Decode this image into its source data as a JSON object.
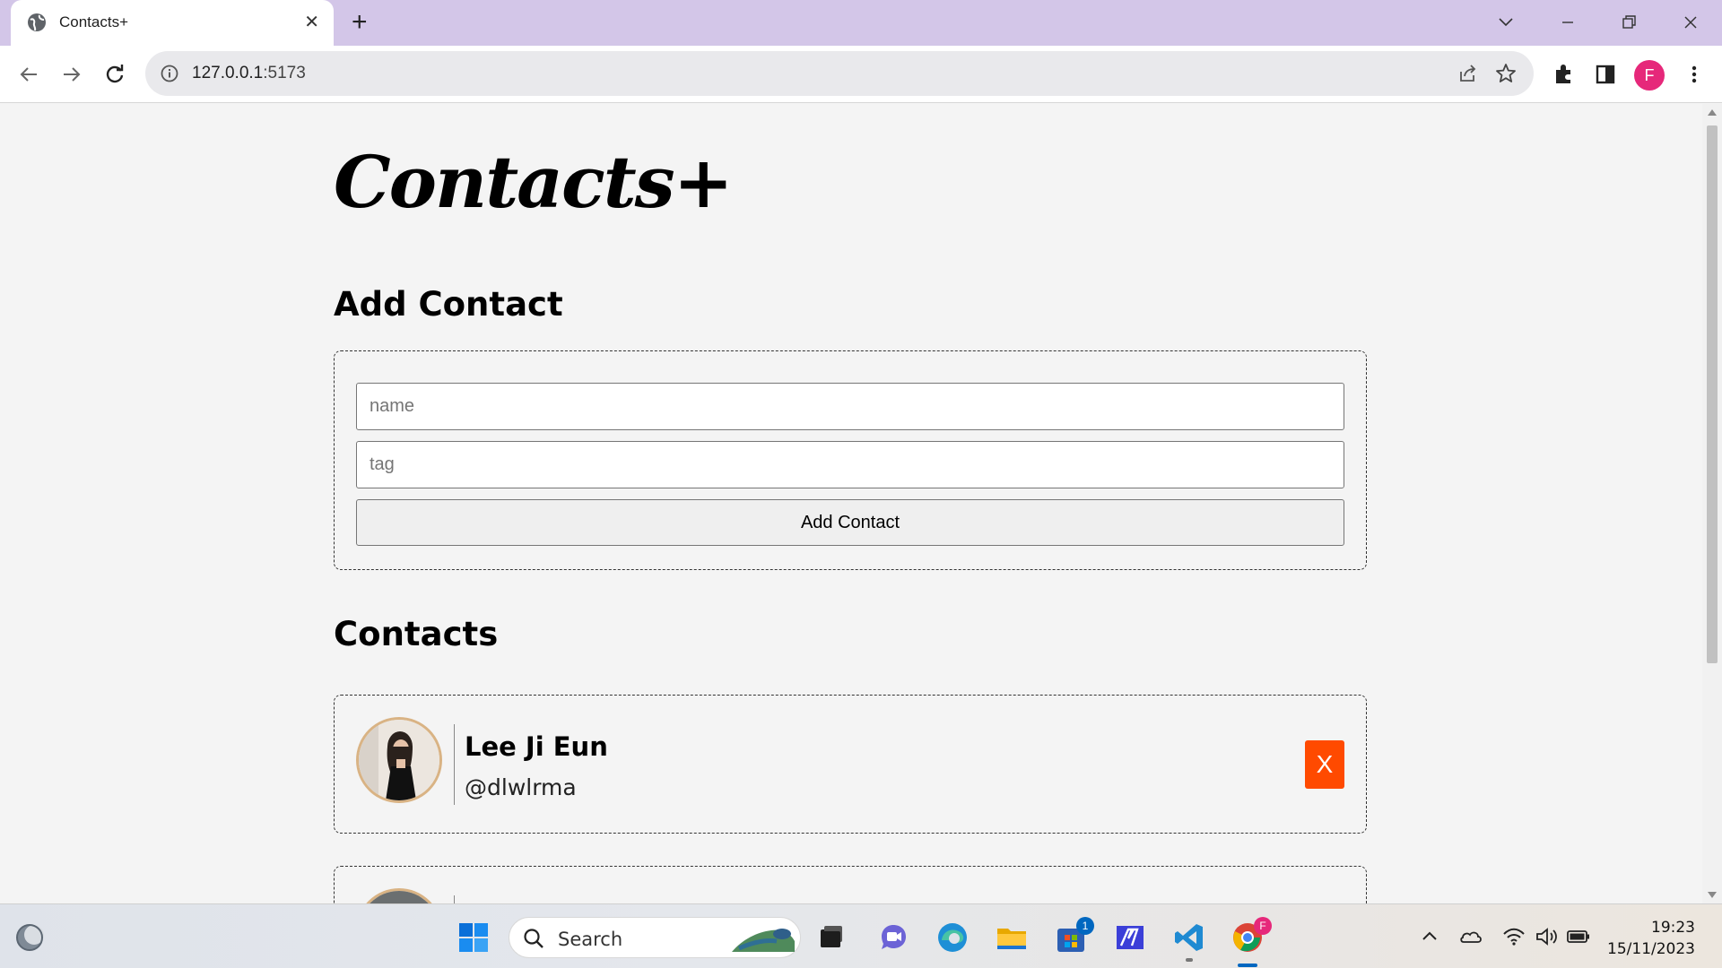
{
  "browser": {
    "tab_title": "Contacts+",
    "new_tab_symbol": "+",
    "close_symbol": "✕",
    "url_host": "127.0.0.1",
    "url_port": ":5173",
    "profile_initial": "F"
  },
  "page": {
    "logo": "Contacts+",
    "add_heading": "Add Contact",
    "name_placeholder": "name",
    "tag_placeholder": "tag",
    "add_button": "Add Contact",
    "contacts_heading": "Contacts",
    "contacts": [
      {
        "name": "Lee Ji Eun",
        "tag": "@dlwlrma",
        "delete_label": "X"
      }
    ]
  },
  "taskbar": {
    "search_label": "Search",
    "store_badge": "1",
    "chrome_badge": "F",
    "time": "19:23",
    "date": "15/11/2023"
  },
  "colors": {
    "tabbar": "#d3c6e8",
    "delete_button": "#ff4a00",
    "avatar_ring": "#d9b384",
    "profile": "#e6287a"
  },
  "icons": [
    "globe-icon",
    "close-icon",
    "plus-icon",
    "chevron-down-icon",
    "minimize-icon",
    "restore-icon",
    "window-close-icon",
    "back-icon",
    "forward-icon",
    "reload-icon",
    "info-icon",
    "share-icon",
    "star-icon",
    "extensions-icon",
    "sidepanel-icon",
    "kebab-menu-icon",
    "windows-start-icon",
    "search-icon",
    "widgets-icon"
  ]
}
